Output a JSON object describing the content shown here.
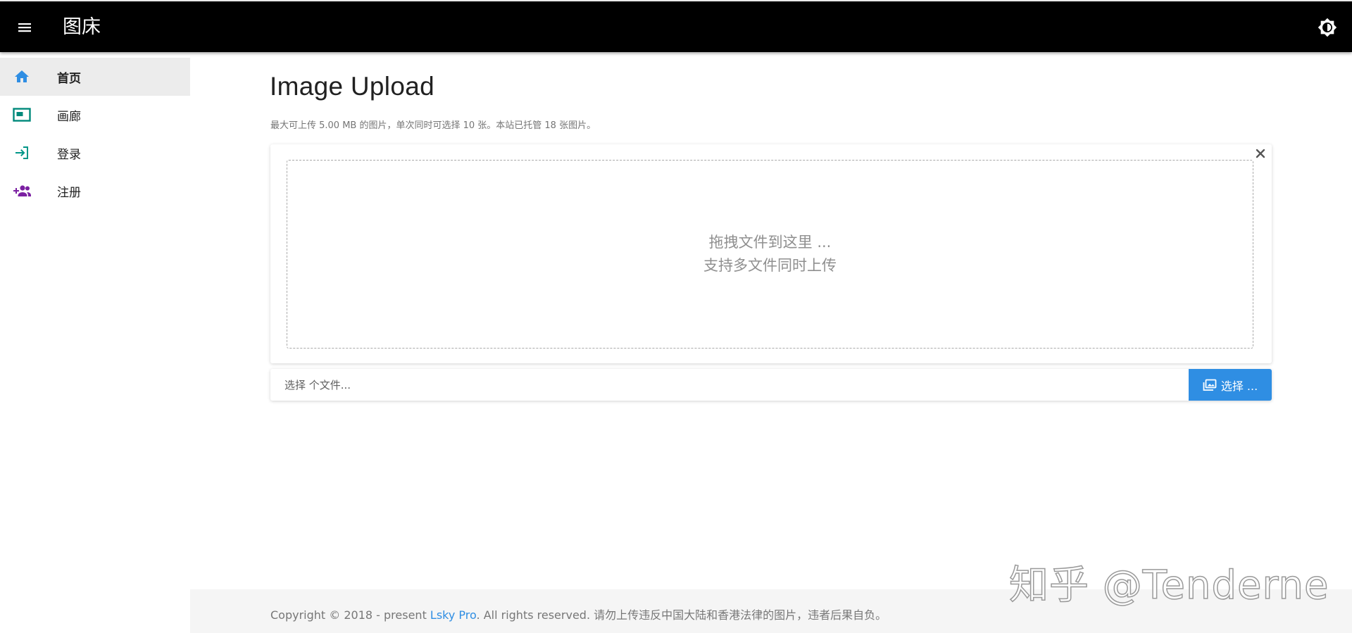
{
  "app": {
    "title": "图床"
  },
  "header": {
    "menu_icon": "menu-icon",
    "theme_icon": "brightness-icon"
  },
  "sidebar": {
    "items": [
      {
        "label": "首页",
        "icon": "home-icon",
        "color": "#2f8ee3",
        "active": true
      },
      {
        "label": "画廊",
        "icon": "gallery-icon",
        "color": "#00897b",
        "active": false
      },
      {
        "label": "登录",
        "icon": "login-icon",
        "color": "#009688",
        "active": false
      },
      {
        "label": "注册",
        "icon": "add-user-icon",
        "color": "#7b1fa2",
        "active": false
      }
    ]
  },
  "main": {
    "title": "Image Upload",
    "subtitle": "最大可上传 5.00 MB 的图片，单次同时可选择 10 张。本站已托管 18 张图片。",
    "dropzone": {
      "line1": "拖拽文件到这里 ...",
      "line2": "支持多文件同时上传"
    },
    "file_input": {
      "placeholder": "选择 个文件..."
    },
    "choose_button": {
      "label": "选择 ..."
    }
  },
  "watermark": {
    "text": "知乎 @Tenderne"
  },
  "footer": {
    "prefix": "Copyright © 2018 - present ",
    "link": "Lsky Pro",
    "suffix": ". All rights reserved. 请勿上传违反中国大陆和香港法律的图片，违者后果自负。"
  },
  "colors": {
    "appbar": "#000000",
    "accent": "#2f8ee3",
    "footer_bg": "#f5f5f5",
    "active_item_bg": "#ececec"
  }
}
